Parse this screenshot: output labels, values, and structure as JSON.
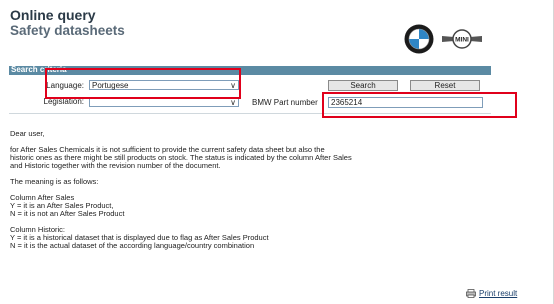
{
  "header": {
    "title": "Online query",
    "subtitle": "Safety datasheets",
    "logos": [
      "bmw-logo",
      "mini-logo"
    ],
    "mini_logo_text": "MINI"
  },
  "search": {
    "section_label": "Search criteria",
    "language_label": "Language:",
    "language_value": "Portugese",
    "legislation_label": "Legislation:",
    "legislation_value": "",
    "part_number_label": "BMW Part number",
    "part_number_value": "2365214",
    "search_button": "Search",
    "reset_button": "Reset"
  },
  "content": {
    "greeting": "Dear user,",
    "intro_line1": "for After Sales Chemicals it is not sufficient to provide the current safety data sheet but also the",
    "intro_line2": "historic ones as there might be still products on stock. The status is indicated by the column After Sales",
    "intro_line3": "and Historic together with the revision number of the document.",
    "meaning": "The meaning is as follows:",
    "after_sales_heading": "Column After Sales",
    "after_sales_y": "Y = it is an After Sales Product,",
    "after_sales_n": "N = it is not an After Sales Product",
    "historic_heading": "Column Historic:",
    "historic_y": "Y = it is a historical dataset that is displayed due to flag as After Sales Product",
    "historic_n": "N = it is the actual dataset of the according language/country combination"
  },
  "footer": {
    "print_label": "Print result"
  },
  "colors": {
    "bar": "#5b8aa3",
    "highlight": "#e0001b",
    "title": "#2b3a47"
  }
}
